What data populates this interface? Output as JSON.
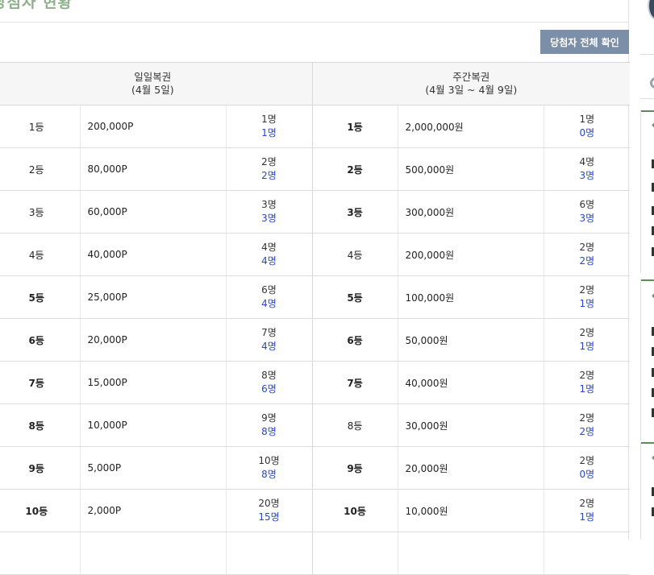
{
  "header": {
    "title": "당첨자 현황",
    "all_winners_button": "당첨자 전체 확인"
  },
  "table": {
    "daily": {
      "title": "일일복권",
      "period": "(4월 5일)"
    },
    "weekly": {
      "title": "주간복권",
      "period": "(4월 3일 ~ 4월 9일)"
    },
    "rows": [
      {
        "d_rank": "1등",
        "d_amount": "200,000P",
        "d_total": "1명",
        "d_count": "1명",
        "w_rank": "1등",
        "w_amount": "2,000,000원",
        "w_total": "1명",
        "w_count": "0명"
      },
      {
        "d_rank": "2등",
        "d_amount": "80,000P",
        "d_total": "2명",
        "d_count": "2명",
        "w_rank": "2등",
        "w_amount": "500,000원",
        "w_total": "4명",
        "w_count": "3명"
      },
      {
        "d_rank": "3등",
        "d_amount": "60,000P",
        "d_total": "3명",
        "d_count": "3명",
        "w_rank": "3등",
        "w_amount": "300,000원",
        "w_total": "6명",
        "w_count": "3명"
      },
      {
        "d_rank": "4등",
        "d_amount": "40,000P",
        "d_total": "4명",
        "d_count": "4명",
        "w_rank": "4등",
        "w_amount": "200,000원",
        "w_total": "2명",
        "w_count": "2명"
      },
      {
        "d_rank": "5등",
        "d_amount": "25,000P",
        "d_total": "6명",
        "d_count": "4명",
        "w_rank": "5등",
        "w_amount": "100,000원",
        "w_total": "2명",
        "w_count": "1명"
      },
      {
        "d_rank": "6등",
        "d_amount": "20,000P",
        "d_total": "7명",
        "d_count": "4명",
        "w_rank": "6등",
        "w_amount": "50,000원",
        "w_total": "2명",
        "w_count": "1명"
      },
      {
        "d_rank": "7등",
        "d_amount": "15,000P",
        "d_total": "8명",
        "d_count": "6명",
        "w_rank": "7등",
        "w_amount": "40,000원",
        "w_total": "2명",
        "w_count": "1명"
      },
      {
        "d_rank": "8등",
        "d_amount": "10,000P",
        "d_total": "9명",
        "d_count": "8명",
        "w_rank": "8등",
        "w_amount": "30,000원",
        "w_total": "2명",
        "w_count": "2명"
      },
      {
        "d_rank": "9등",
        "d_amount": "5,000P",
        "d_total": "10명",
        "d_count": "8명",
        "w_rank": "9등",
        "w_amount": "20,000원",
        "w_total": "2명",
        "w_count": "0명"
      },
      {
        "d_rank": "10등",
        "d_amount": "2,000P",
        "d_total": "20명",
        "d_count": "15명",
        "w_rank": "10등",
        "w_amount": "10,000원",
        "w_total": "2명",
        "w_count": "1명"
      }
    ]
  },
  "styles": {
    "bold_daily_ranks": [
      5,
      6,
      7,
      8,
      9,
      10
    ],
    "bold_weekly_ranks": [
      1,
      2,
      3,
      5,
      6,
      7,
      9,
      10
    ]
  },
  "colors": {
    "title": "#8eb08a",
    "button_bg": "#7c8fa8",
    "count_blue": "#2747c8",
    "sidebar_accent": "#5b8c5a"
  },
  "sidebar": {
    "icons": [
      "avatar-icon",
      "loading-ring-icon"
    ]
  }
}
